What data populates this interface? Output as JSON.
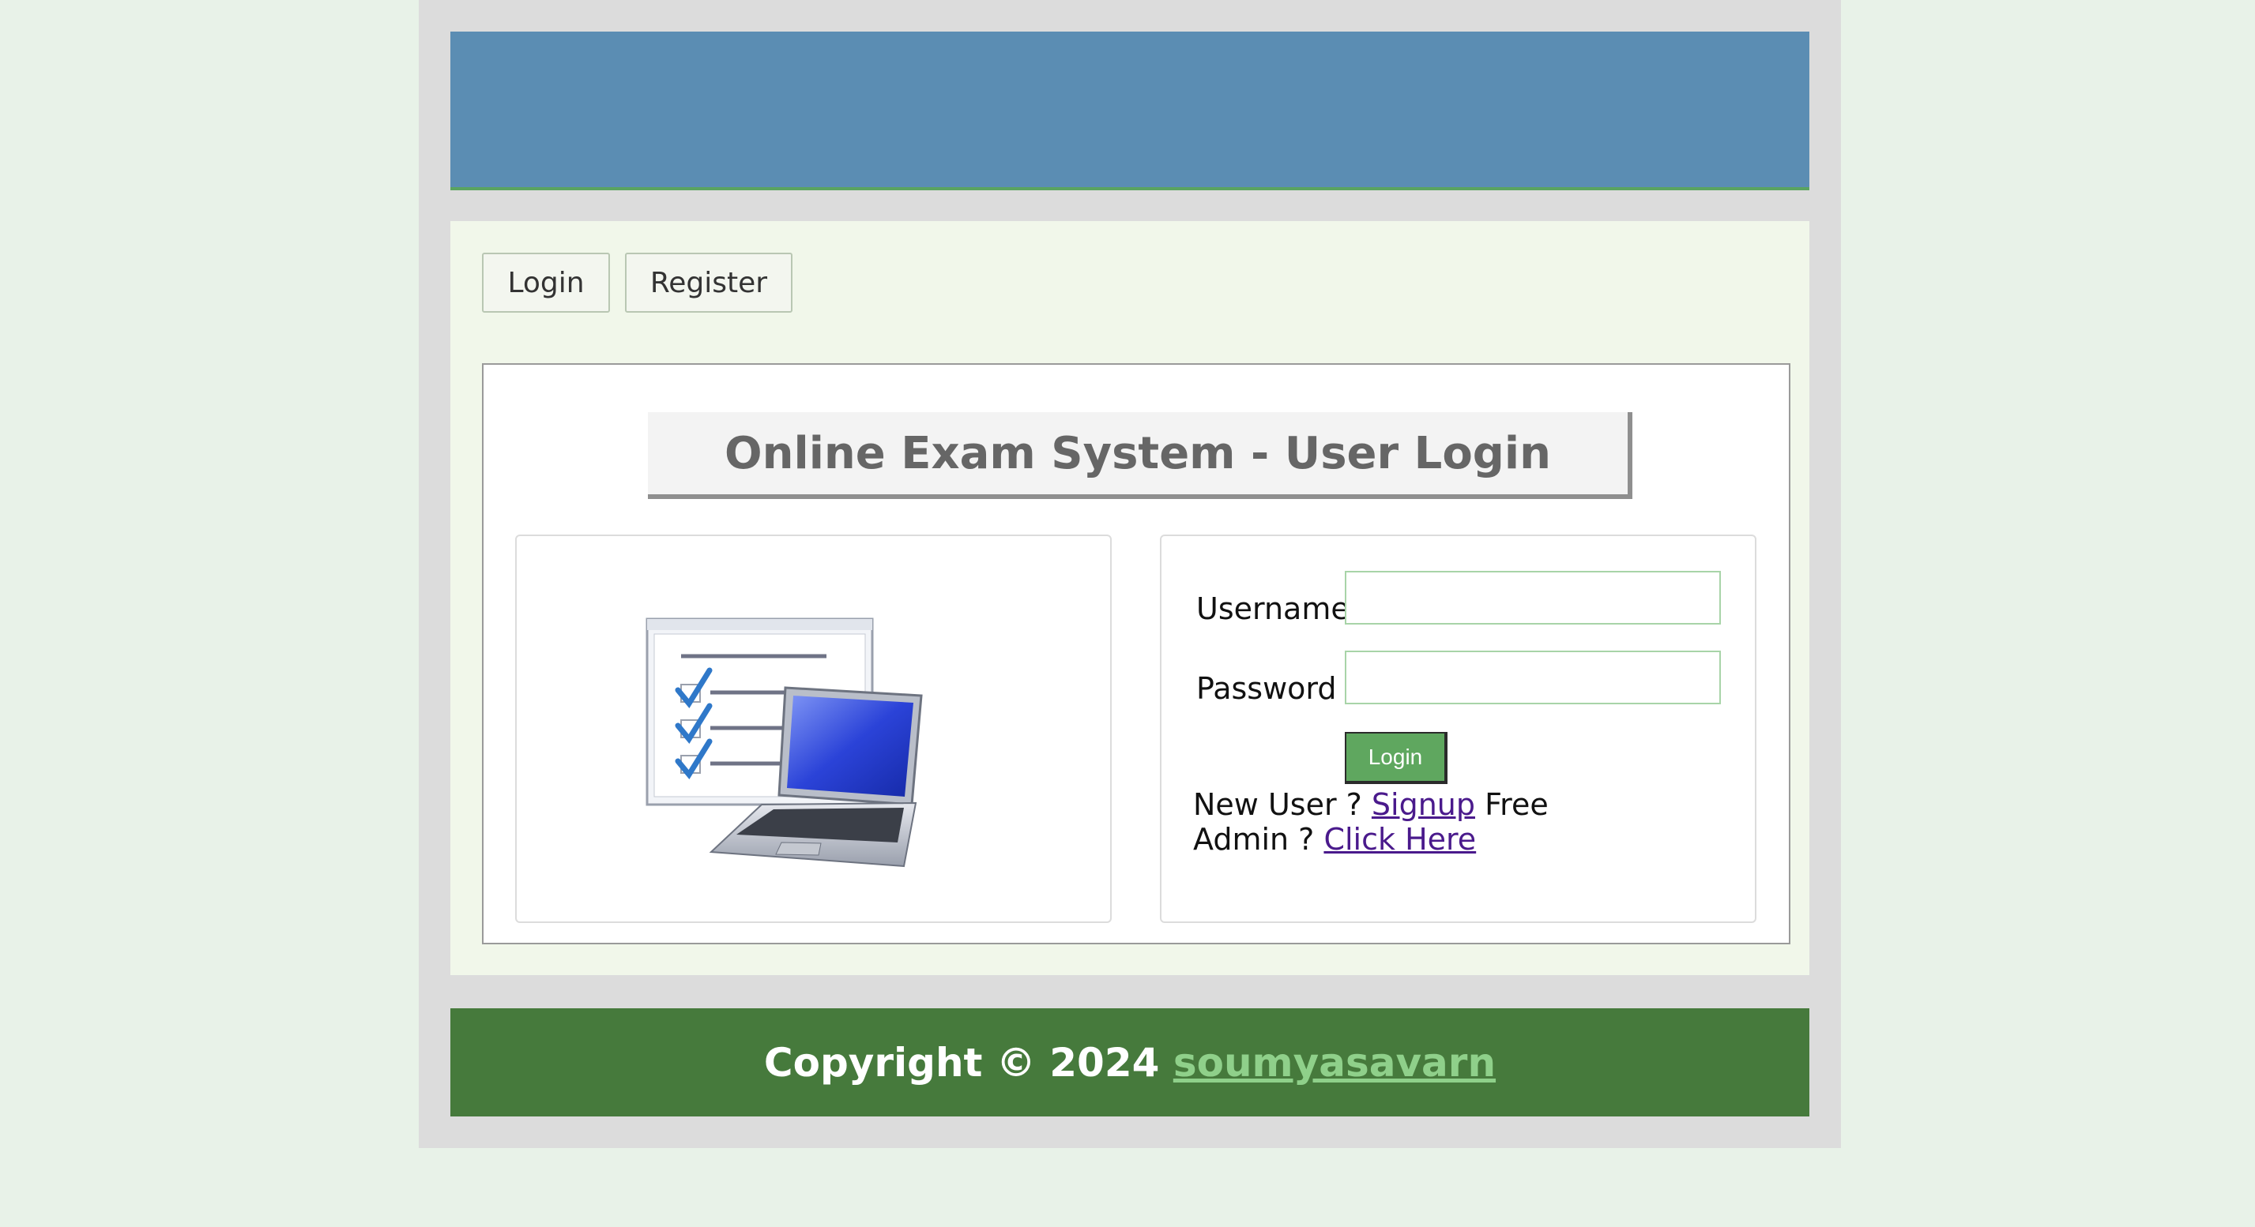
{
  "nav": {
    "login_label": "Login",
    "register_label": "Register"
  },
  "page_title": "Online Exam System - User Login",
  "illustration": {
    "icon": "exam-checklist-laptop-icon"
  },
  "form": {
    "username_label": "Username",
    "username_value": "",
    "password_label": "Password",
    "password_value": "",
    "submit_label": "Login",
    "new_user_prefix": "New User ? ",
    "signup_link": "Signup",
    "new_user_suffix": " Free",
    "admin_prefix": "Admin ? ",
    "admin_link": "Click Here"
  },
  "footer": {
    "copyright": "Copyright © 2024 ",
    "author_link": "soumyasavarn"
  },
  "colors": {
    "header": "#5b8db3",
    "footer": "#467a3c",
    "button_green": "#5fa75f",
    "link_visited": "#4a1a8c",
    "footer_link": "#8fd08a"
  }
}
